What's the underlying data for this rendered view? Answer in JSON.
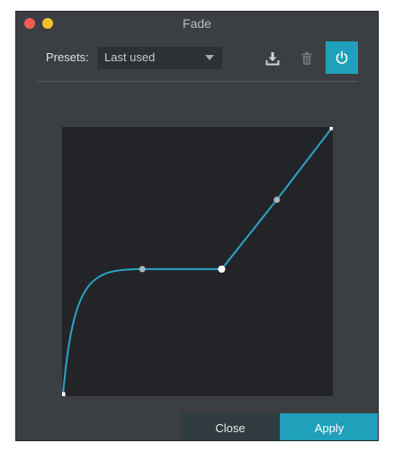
{
  "window": {
    "title": "Fade"
  },
  "presets": {
    "label": "Presets:",
    "selected": "Last used"
  },
  "toolbar": {
    "save_icon": "download-icon",
    "delete_icon": "trash-icon",
    "power_icon": "power-icon",
    "accent_color": "#20a0ba"
  },
  "curve": {
    "line_color": "#2ba3c4",
    "background": "#232428",
    "points": [
      {
        "x": 0.0,
        "y": 0.0,
        "type": "endpoint"
      },
      {
        "x": 0.295,
        "y": 0.47,
        "type": "control"
      },
      {
        "x": 0.59,
        "y": 0.47,
        "type": "node"
      },
      {
        "x": 0.795,
        "y": 0.73,
        "type": "control"
      },
      {
        "x": 1.0,
        "y": 1.0,
        "type": "endpoint"
      }
    ]
  },
  "footer": {
    "close_label": "Close",
    "apply_label": "Apply"
  }
}
